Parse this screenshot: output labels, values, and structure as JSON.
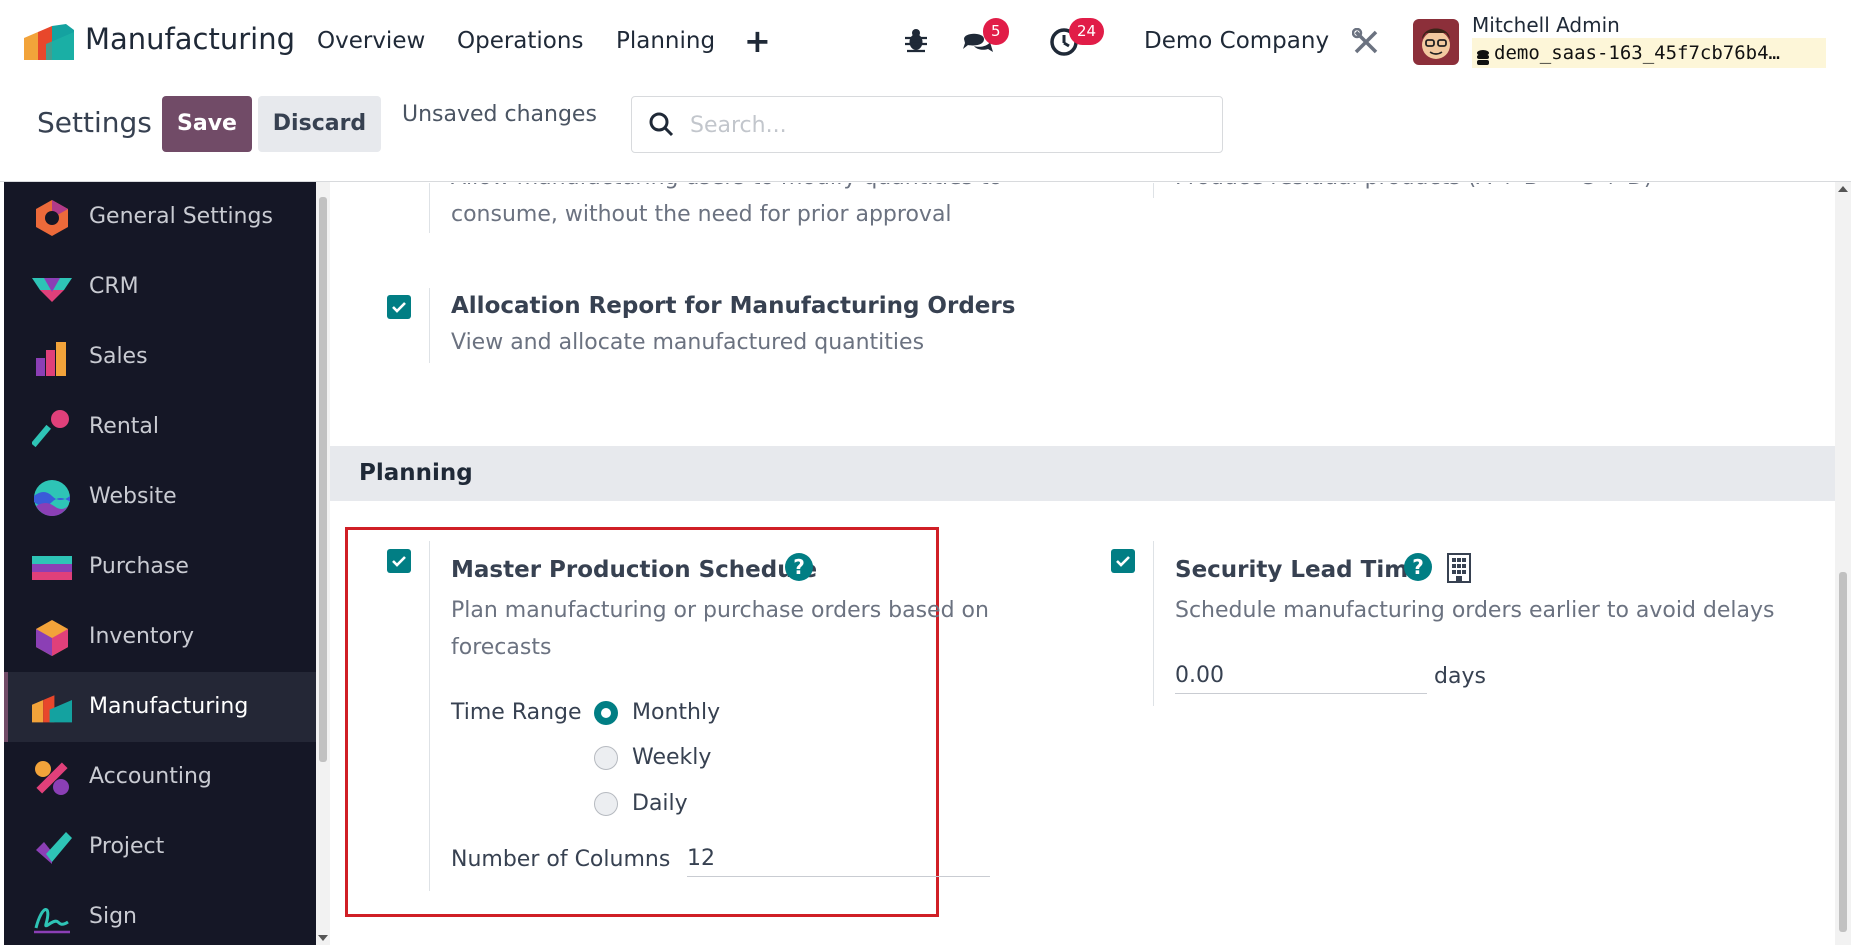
{
  "topnav": {
    "app_name": "Manufacturing",
    "menu": [
      "Overview",
      "Operations",
      "Planning"
    ],
    "plus_label": "+",
    "messages_count": "5",
    "activities_count": "24",
    "company": "Demo Company",
    "user_name": "Mitchell Admin",
    "database": "demo_saas-163_45f7cb76b4…"
  },
  "control_panel": {
    "breadcrumb": "Settings",
    "save_label": "Save",
    "discard_label": "Discard",
    "status": "Unsaved changes",
    "search_placeholder": "Search..."
  },
  "sidebar": {
    "items": [
      {
        "label": "General Settings",
        "icon": "general-settings-icon"
      },
      {
        "label": "CRM",
        "icon": "crm-icon"
      },
      {
        "label": "Sales",
        "icon": "sales-icon"
      },
      {
        "label": "Rental",
        "icon": "rental-icon"
      },
      {
        "label": "Website",
        "icon": "website-icon"
      },
      {
        "label": "Purchase",
        "icon": "purchase-icon"
      },
      {
        "label": "Inventory",
        "icon": "inventory-icon"
      },
      {
        "label": "Manufacturing",
        "icon": "manufacturing-icon",
        "active": true
      },
      {
        "label": "Accounting",
        "icon": "accounting-icon"
      },
      {
        "label": "Project",
        "icon": "project-icon"
      },
      {
        "label": "Sign",
        "icon": "sign-icon"
      }
    ]
  },
  "main": {
    "partial_top_left": "Allow manufacturing users to modify quantities to",
    "partial_top_left_2": "consume, without the need for prior approval",
    "partial_top_right": "Produce residual products (A + B -> C + D)",
    "allocation": {
      "title": "Allocation Report for Manufacturing Orders",
      "desc": "View and allocate manufactured quantities",
      "checked": true
    },
    "section_title": "Planning",
    "mps": {
      "title": "Master Production Schedule",
      "desc_line1": "Plan manufacturing or purchase orders based on",
      "desc_line2": "forecasts",
      "checked": true,
      "time_range_label": "Time Range",
      "options": [
        "Monthly",
        "Weekly",
        "Daily"
      ],
      "selected": "Monthly",
      "columns_label": "Number of Columns",
      "columns_value": "12"
    },
    "security_lead": {
      "title": "Security Lead Time",
      "desc": "Schedule manufacturing orders earlier to avoid delays",
      "checked": true,
      "value": "0.00",
      "unit": "days"
    }
  },
  "colors": {
    "brand": "#714b67",
    "accent": "#017e84",
    "badge": "#e11d48",
    "highlight": "#d01f26",
    "sidebar_bg": "#151726"
  }
}
